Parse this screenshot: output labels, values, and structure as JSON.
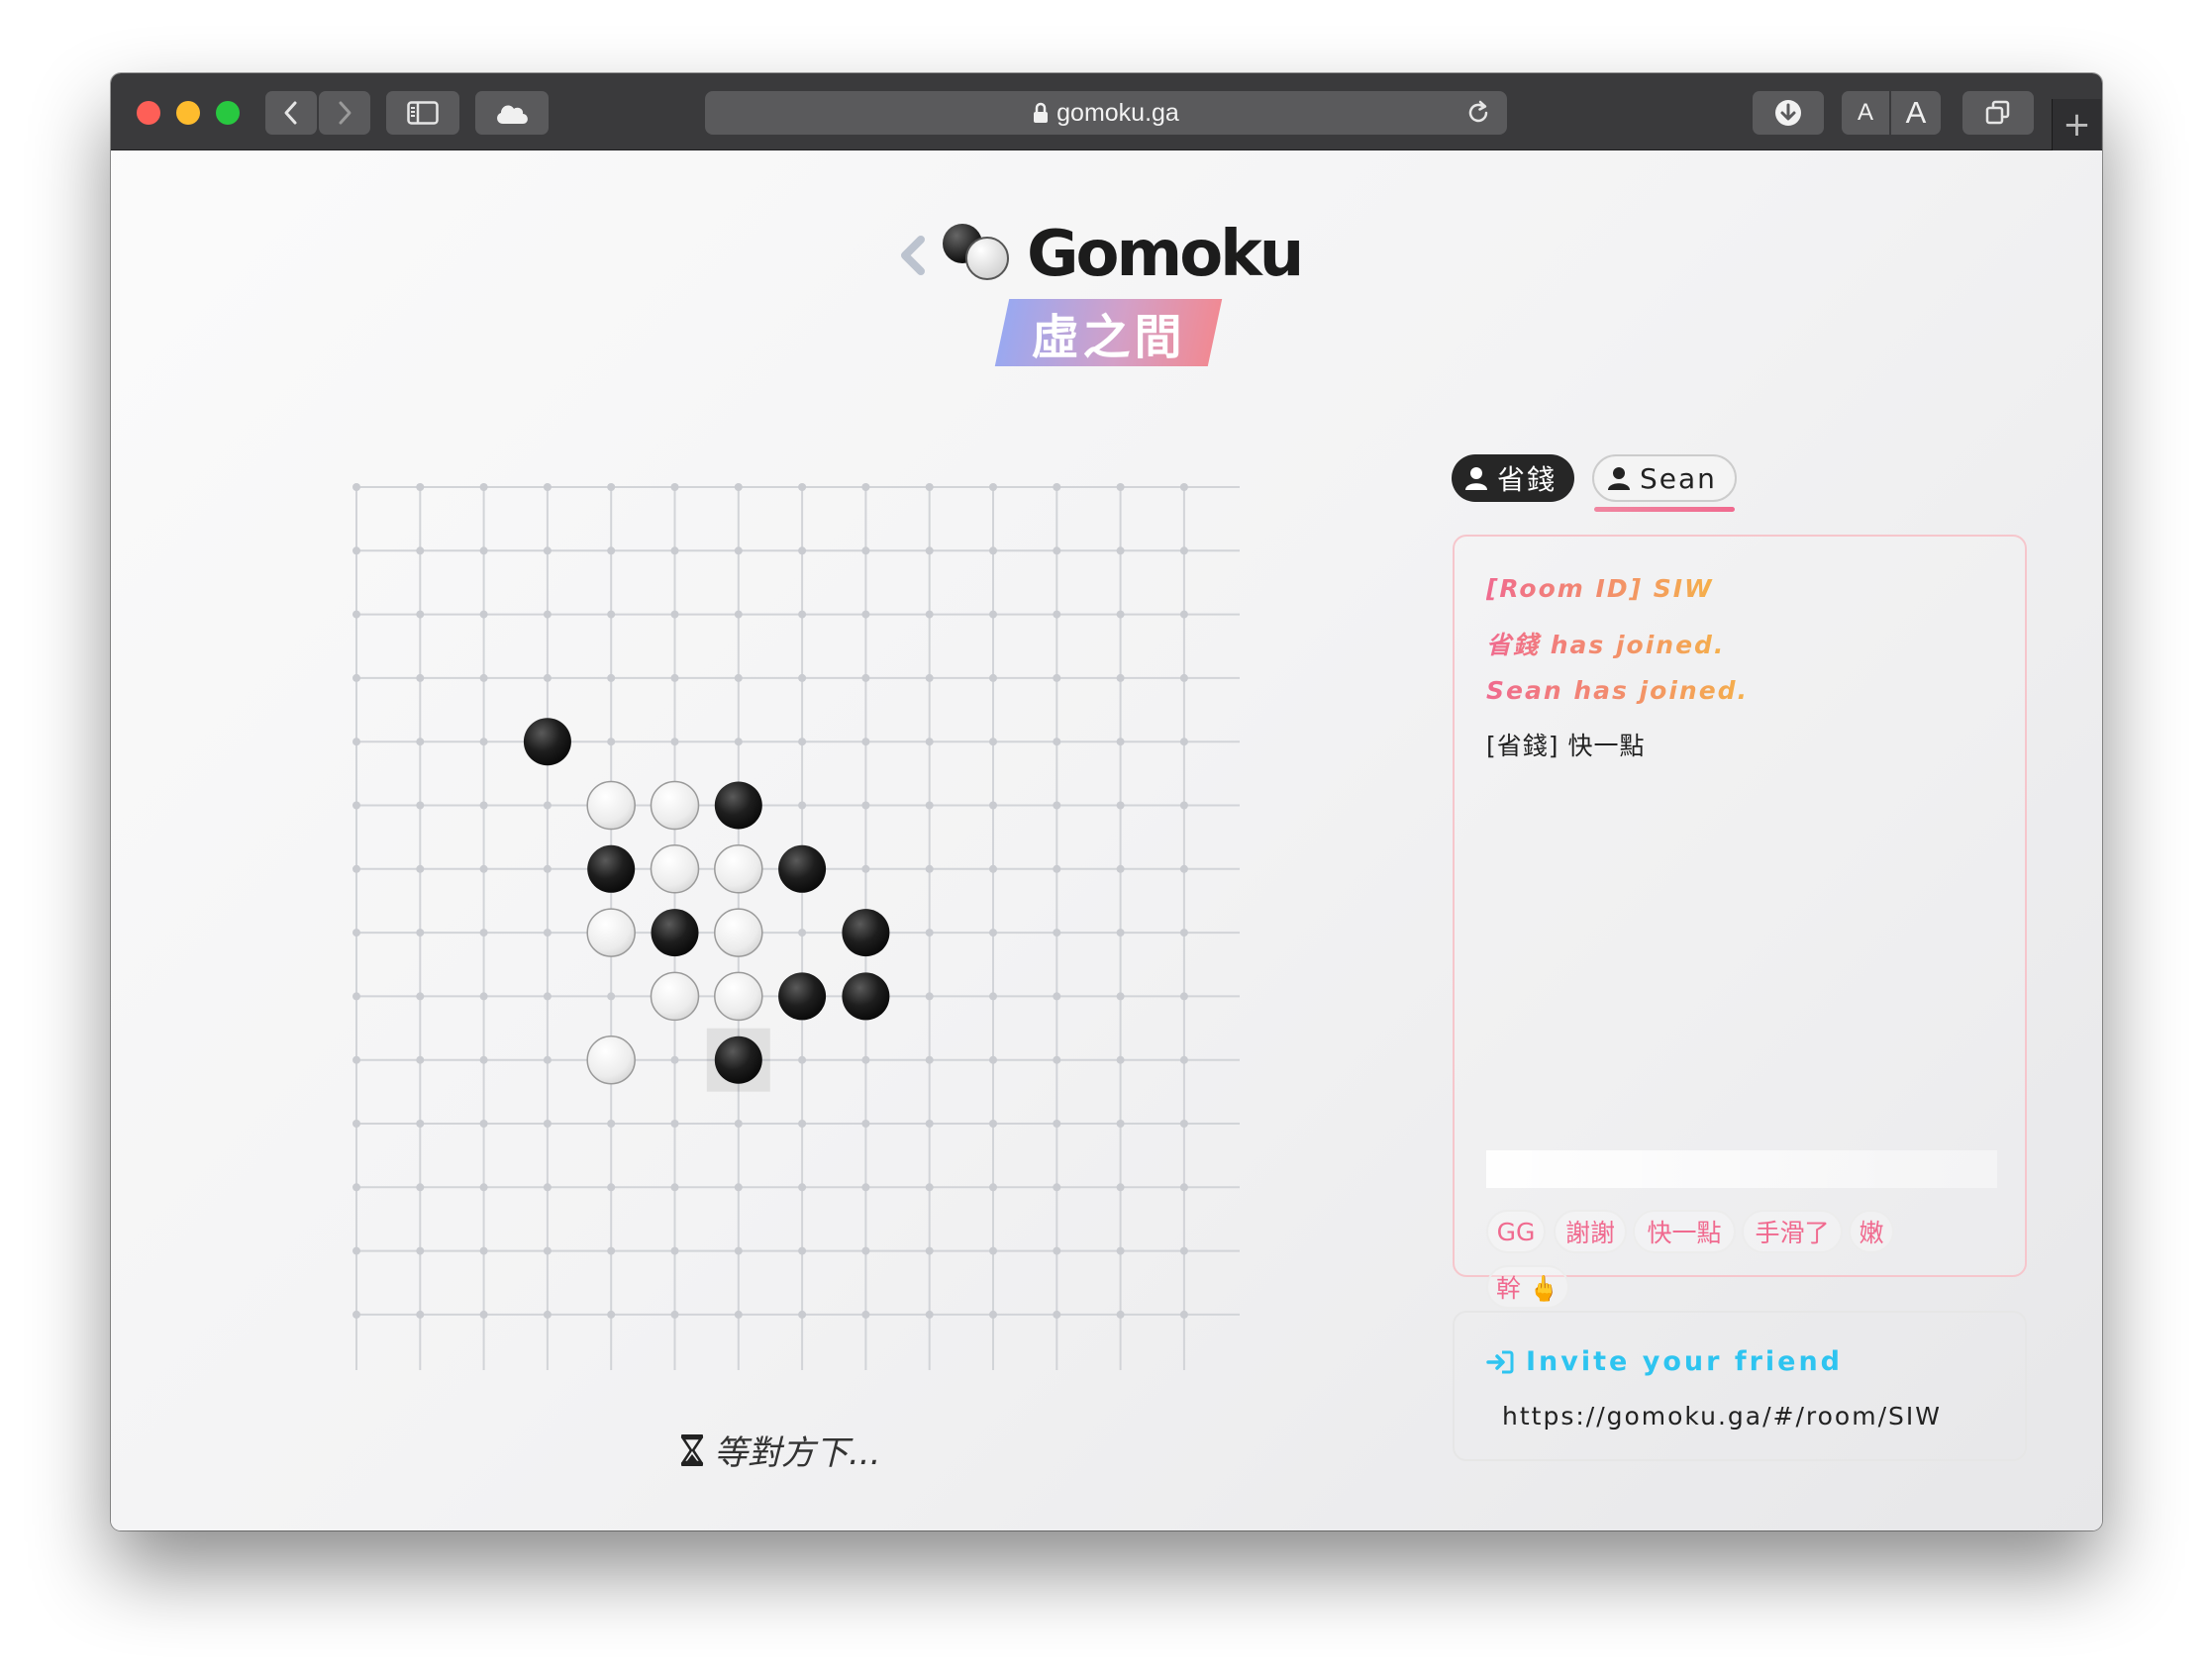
{
  "browser": {
    "url": "gomoku.ga",
    "text_size_small": "A",
    "text_size_large": "A",
    "new_tab": "+"
  },
  "header": {
    "title": "Gomoku",
    "subtitle": "虛之間"
  },
  "board": {
    "size": 15,
    "stones": [
      {
        "col": 3,
        "row": 4,
        "color": "black"
      },
      {
        "col": 4,
        "row": 5,
        "color": "white"
      },
      {
        "col": 5,
        "row": 5,
        "color": "white"
      },
      {
        "col": 6,
        "row": 5,
        "color": "black"
      },
      {
        "col": 4,
        "row": 6,
        "color": "black"
      },
      {
        "col": 5,
        "row": 6,
        "color": "white"
      },
      {
        "col": 6,
        "row": 6,
        "color": "white"
      },
      {
        "col": 7,
        "row": 6,
        "color": "black"
      },
      {
        "col": 4,
        "row": 7,
        "color": "white"
      },
      {
        "col": 5,
        "row": 7,
        "color": "black"
      },
      {
        "col": 6,
        "row": 7,
        "color": "white"
      },
      {
        "col": 8,
        "row": 7,
        "color": "black"
      },
      {
        "col": 5,
        "row": 8,
        "color": "white"
      },
      {
        "col": 6,
        "row": 8,
        "color": "white"
      },
      {
        "col": 7,
        "row": 8,
        "color": "black"
      },
      {
        "col": 8,
        "row": 8,
        "color": "black"
      },
      {
        "col": 4,
        "row": 9,
        "color": "white"
      },
      {
        "col": 6,
        "row": 9,
        "color": "black",
        "last_move": true
      }
    ]
  },
  "status": {
    "text": "等對方下..."
  },
  "players": [
    {
      "name": "省錢",
      "active": false
    },
    {
      "name": "Sean",
      "active": true
    }
  ],
  "chat": {
    "room_line": "[Room ID] SIW",
    "join_line_1": "省錢 has joined.",
    "join_line_2": "Sean has joined.",
    "message_line": "[省錢] 快一點",
    "input_value": "",
    "quick_replies": [
      "GG",
      "謝謝",
      "快一點",
      "手滑了",
      "嫩",
      "幹 🖕"
    ]
  },
  "invite": {
    "title": "Invite your friend",
    "url": "https://gomoku.ga/#/room/SIW"
  },
  "colors": {
    "accent_pink": "#f06a8f",
    "accent_orange": "#f5b04a",
    "invite_blue": "#2ec4f0",
    "titlebar": "#3a3a3c"
  }
}
